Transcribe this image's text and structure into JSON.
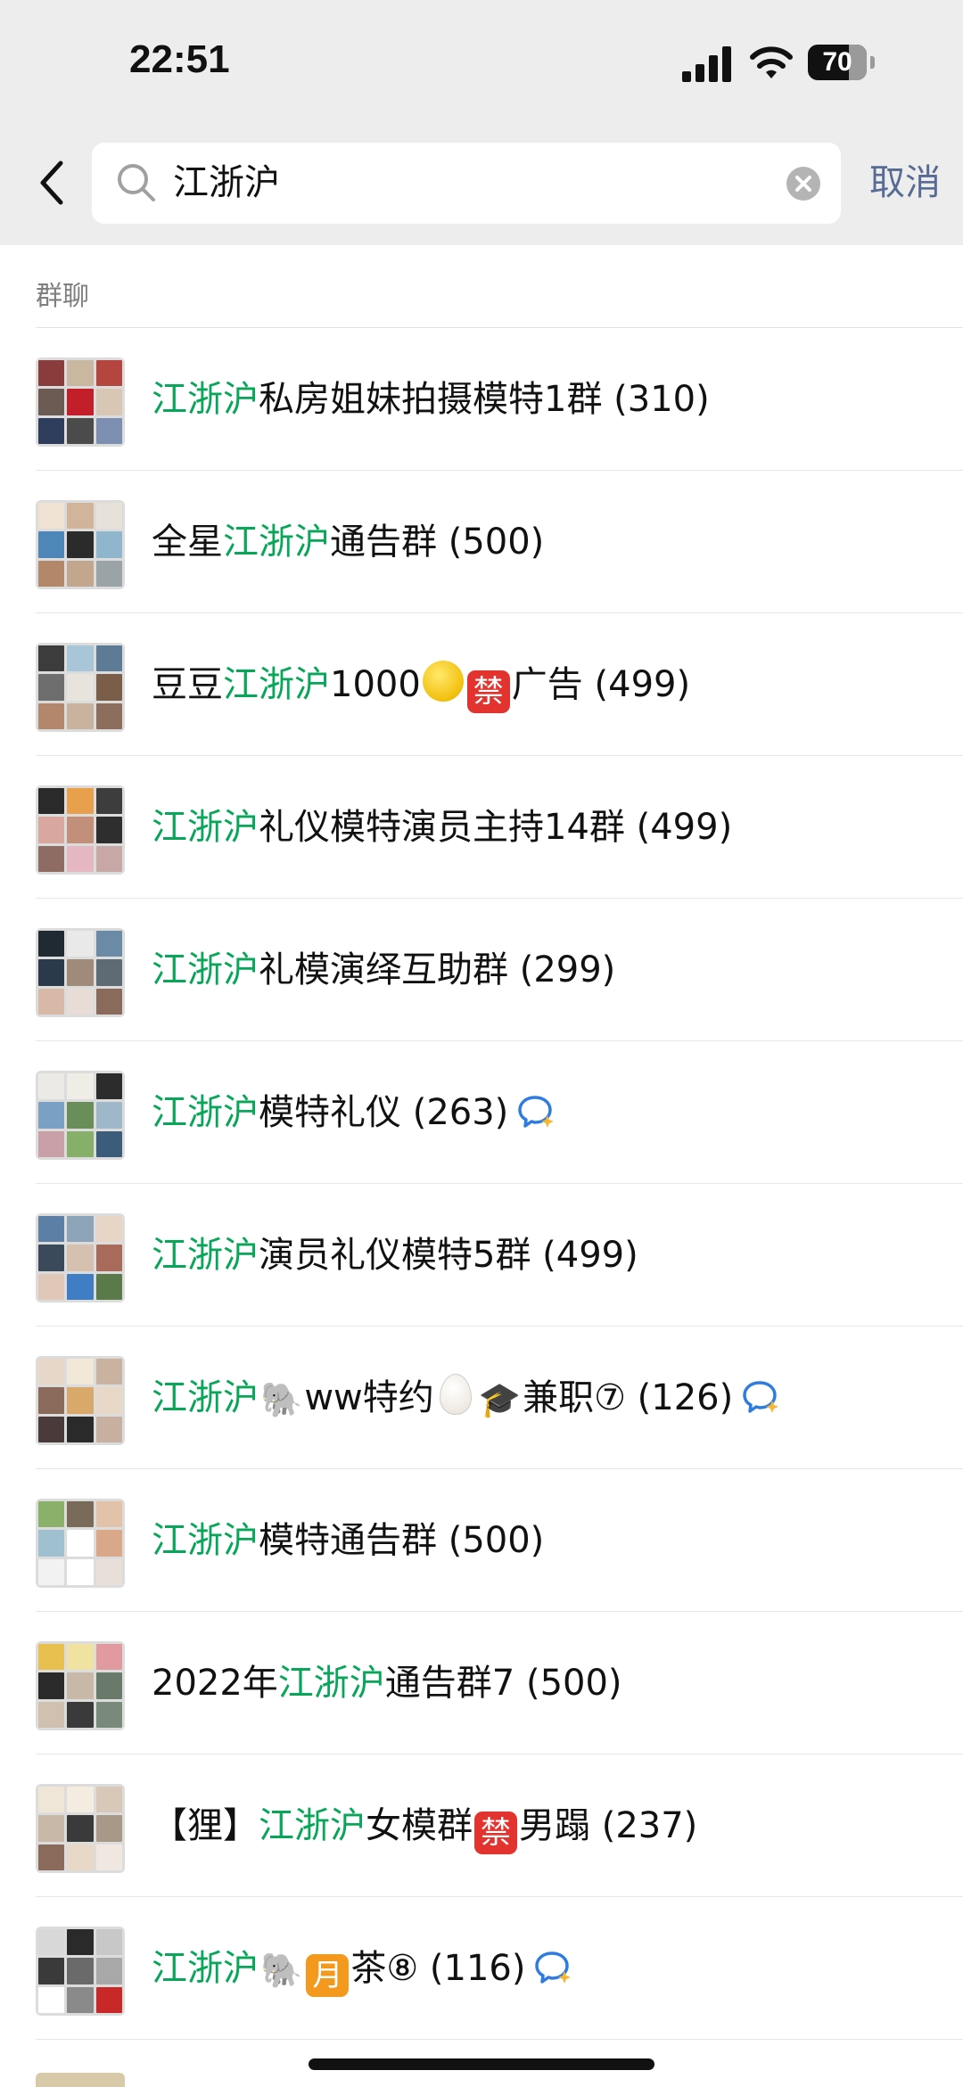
{
  "status_bar": {
    "time": "22:51",
    "battery": "70",
    "battery_level": 0.7
  },
  "search": {
    "query": "江浙沪",
    "cancel_label": "取消"
  },
  "section_title": "群聊",
  "results": [
    {
      "highlight_leading": "",
      "highlight": "江浙沪",
      "rest_text": "私房姐妹拍摄模特1群 (310)",
      "avatar_colors": [
        "#8a3b3b",
        "#c9b7a0",
        "#b5463f",
        "#6b5b52",
        "#c21f2a",
        "#d9c7b5",
        "#2f3d5c",
        "#4b4b4b",
        "#7c8fb0"
      ]
    },
    {
      "highlight_leading": "全星",
      "highlight": "江浙沪",
      "rest_text": "通告群 (500)",
      "avatar_colors": [
        "#f1e3d3",
        "#d2b49a",
        "#e7e1da",
        "#4f86b8",
        "#2b2b2b",
        "#8fb6cc",
        "#b3886a",
        "#c2a68d",
        "#9aa3a8"
      ]
    },
    {
      "highlight_leading": "豆豆",
      "highlight": "江浙沪",
      "rest_text": "1000",
      "tags": [
        "coin",
        "jin"
      ],
      "tail_text": "广告 (499)",
      "avatar_colors": [
        "#3c3c3c",
        "#a9c6d9",
        "#5d7b95",
        "#6e6e6e",
        "#e8e3dc",
        "#7b5e4a",
        "#b3876b",
        "#c9b29e",
        "#8d6e5c"
      ]
    },
    {
      "highlight_leading": "",
      "highlight": "江浙沪",
      "rest_text": "礼仪模特演员主持14群 (499)",
      "avatar_colors": [
        "#2a2a2a",
        "#e8a04c",
        "#3d3d3d",
        "#d8a8a0",
        "#c18f7a",
        "#2e2e2e",
        "#8e6b63",
        "#e5b7c1",
        "#c7a8a6"
      ]
    },
    {
      "highlight_leading": "",
      "highlight": "江浙沪",
      "rest_text": "礼模演绎互助群 (299)",
      "avatar_colors": [
        "#1f2a33",
        "#e9e9e9",
        "#6a8aa6",
        "#2b3a4a",
        "#a08a7a",
        "#5e6a74",
        "#d8b8a6",
        "#e8ddd6",
        "#8a6a5a"
      ]
    },
    {
      "highlight_leading": "",
      "highlight": "江浙沪",
      "rest_text": "模特礼仪 (263)",
      "bubble": true,
      "avatar_colors": [
        "#eceae6",
        "#f0ece6",
        "#2c2c2c",
        "#7aa0c4",
        "#6a8e5a",
        "#9fb8c9",
        "#c9a0a8",
        "#86b06a",
        "#3b5c7a"
      ]
    },
    {
      "highlight_leading": "",
      "highlight": "江浙沪",
      "rest_text": "演员礼仪模特5群 (499)",
      "avatar_colors": [
        "#5c7fa6",
        "#8da3b8",
        "#e7d5c5",
        "#3b4a5a",
        "#d6c0b0",
        "#a86a5a",
        "#e0c8b8",
        "#3f7ec4",
        "#5a7a4a"
      ]
    },
    {
      "highlight_leading": "",
      "highlight": "江浙沪",
      "rest_text": "ww特约",
      "middle": [
        "elephant",
        "egg",
        "cap"
      ],
      "tail_text": "兼职⑦ (126)",
      "bubble": true,
      "elephant_icon": "elephant-icon",
      "cap_icon": "graduation-cap-icon",
      "avatar_colors": [
        "#e6d7c8",
        "#f2e8d8",
        "#c9b3a0",
        "#8a6a5a",
        "#d9a86b",
        "#e8d8c8",
        "#4a3a3a",
        "#2a2a2a",
        "#c8b0a0"
      ]
    },
    {
      "highlight_leading": "",
      "highlight": "江浙沪",
      "rest_text": "模特通告群 (500)",
      "avatar_colors": [
        "#8ab06a",
        "#7a6a5a",
        "#e2c2a8",
        "#9fc0cf",
        "#ffffff",
        "#d8a888",
        "#f2f2f2",
        "#ffffff",
        "#e8e0d8"
      ]
    },
    {
      "highlight_leading": "2022年",
      "highlight": "江浙沪",
      "rest_text": "通告群7 (500)",
      "avatar_colors": [
        "#e8c050",
        "#f0e2a0",
        "#e09aa0",
        "#2a2a2a",
        "#c8b8a8",
        "#6a7a6a",
        "#d0c0b0",
        "#3a3a3a",
        "#7a8a7a"
      ]
    },
    {
      "highlight_leading": "【狸】",
      "highlight": "江浙沪",
      "rest_text": "女模群",
      "tags": [
        "jin"
      ],
      "tail_text": "男蹋 (237)",
      "avatar_colors": [
        "#f0e6d8",
        "#f4ece0",
        "#d8c8b8",
        "#c8b8a8",
        "#3a3a3a",
        "#a89888",
        "#8a6a5a",
        "#e8d8c8",
        "#f0e8e0"
      ]
    },
    {
      "highlight_leading": "",
      "highlight": "江浙沪",
      "rest_text": "",
      "middle": [
        "elephant"
      ],
      "tags": [
        "yue"
      ],
      "tail_text": "茶⑧ (116)",
      "bubble": true,
      "avatar_colors": [
        "#d8d8d8",
        "#2a2a2a",
        "#c8c8c8",
        "#3a3a3a",
        "#6a6a6a",
        "#a8a8a8",
        "#ffffff",
        "#8a8a8a",
        "#c82828"
      ]
    }
  ],
  "icons": {
    "back": "chevron-left-icon",
    "search": "search-icon",
    "clear": "clear-icon",
    "bubble": "chat-bubble-icon",
    "coin": "coin-emoji-icon",
    "jin": "禁",
    "yue": "月"
  },
  "colors": {
    "highlight": "#07a659",
    "cancel": "#576b95",
    "background": "#ededed"
  }
}
